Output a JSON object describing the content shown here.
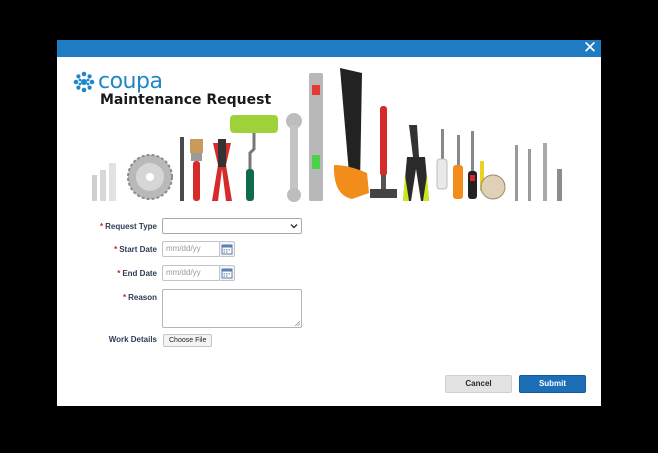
{
  "dialog": {
    "close_icon": "close-icon",
    "brand": {
      "logo_text": "coupa",
      "logo_icon": "coupa-snowflake-icon",
      "color": "#1f86c9"
    },
    "title": "Maintenance Request",
    "accent_color": "#1f7cc2"
  },
  "form": {
    "request_type": {
      "label": "Request Type",
      "required": "*",
      "value": ""
    },
    "start_date": {
      "label": "Start Date",
      "required": "*",
      "placeholder": "mm/dd/yy"
    },
    "end_date": {
      "label": "End Date",
      "required": "*",
      "placeholder": "mm/dd/yy"
    },
    "reason": {
      "label": "Reason",
      "required": "*",
      "value": ""
    },
    "work_details": {
      "label": "Work Details",
      "button": "Choose File"
    }
  },
  "actions": {
    "cancel": "Cancel",
    "submit": "Submit",
    "submit_color": "#1c6fb7"
  }
}
